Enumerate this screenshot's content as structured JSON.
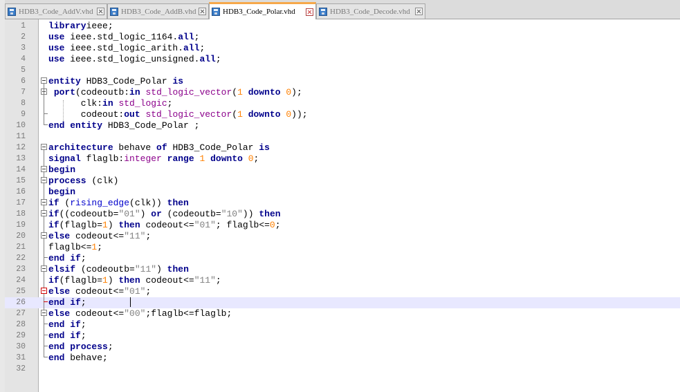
{
  "tabs": [
    {
      "label": "HDB3_Code_AddV.vhd",
      "active": false
    },
    {
      "label": "HDB3_Code_AddB.vhd",
      "active": false
    },
    {
      "label": "HDB3_Code_Polar.vhd",
      "active": true
    },
    {
      "label": "HDB3_Code_Decode.vhd",
      "active": false
    }
  ],
  "editor": {
    "current_line": 26,
    "line_numbers": [
      "1",
      "2",
      "3",
      "4",
      "5",
      "6",
      "7",
      "8",
      "9",
      "10",
      "11",
      "12",
      "13",
      "14",
      "15",
      "16",
      "17",
      "18",
      "19",
      "20",
      "21",
      "22",
      "23",
      "24",
      "25",
      "26",
      "27",
      "28",
      "29",
      "30",
      "31",
      "32"
    ],
    "lines": [
      [
        [
          "kw",
          "library"
        ],
        [
          "",
          "ieee;"
        ]
      ],
      [
        [
          "kw",
          "use"
        ],
        [
          "",
          " ieee.std_logic_1164."
        ],
        [
          "kw",
          "all"
        ],
        [
          "",
          ";"
        ]
      ],
      [
        [
          "kw",
          "use"
        ],
        [
          "",
          " ieee.std_logic_arith."
        ],
        [
          "kw",
          "all"
        ],
        [
          "",
          ";"
        ]
      ],
      [
        [
          "kw",
          "use"
        ],
        [
          "",
          " ieee.std_logic_unsigned."
        ],
        [
          "kw",
          "all"
        ],
        [
          "",
          ";"
        ]
      ],
      [],
      [
        [
          "kw",
          "entity"
        ],
        [
          "",
          " HDB3_Code_Polar "
        ],
        [
          "kw",
          "is"
        ]
      ],
      [
        [
          "",
          " "
        ],
        [
          "kw",
          "port"
        ],
        [
          "",
          "(codeoutb:"
        ],
        [
          "kw",
          "in"
        ],
        [
          "",
          " "
        ],
        [
          "ty",
          "std_logic_vector"
        ],
        [
          "",
          "("
        ],
        [
          "num",
          "1"
        ],
        [
          "",
          " "
        ],
        [
          "kw",
          "downto"
        ],
        [
          "",
          " "
        ],
        [
          "num",
          "0"
        ],
        [
          "",
          ");"
        ]
      ],
      [
        [
          "",
          "      clk:"
        ],
        [
          "kw",
          "in"
        ],
        [
          "",
          " "
        ],
        [
          "ty",
          "std_logic"
        ],
        [
          "",
          ";"
        ]
      ],
      [
        [
          "",
          "      codeout:"
        ],
        [
          "kw",
          "out"
        ],
        [
          "",
          " "
        ],
        [
          "ty",
          "std_logic_vector"
        ],
        [
          "",
          "("
        ],
        [
          "num",
          "1"
        ],
        [
          "",
          " "
        ],
        [
          "kw",
          "downto"
        ],
        [
          "",
          " "
        ],
        [
          "num",
          "0"
        ],
        [
          "",
          "));"
        ]
      ],
      [
        [
          "kw",
          "end"
        ],
        [
          "",
          " "
        ],
        [
          "kw",
          "entity"
        ],
        [
          "",
          " HDB3_Code_Polar ;"
        ]
      ],
      [],
      [
        [
          "kw",
          "architecture"
        ],
        [
          "",
          " behave "
        ],
        [
          "kw",
          "of"
        ],
        [
          "",
          " HDB3_Code_Polar "
        ],
        [
          "kw",
          "is"
        ]
      ],
      [
        [
          "kw",
          "signal"
        ],
        [
          "",
          " flaglb:"
        ],
        [
          "ty",
          "integer"
        ],
        [
          "",
          " "
        ],
        [
          "kw",
          "range"
        ],
        [
          "",
          " "
        ],
        [
          "num",
          "1"
        ],
        [
          "",
          " "
        ],
        [
          "kw",
          "downto"
        ],
        [
          "",
          " "
        ],
        [
          "num",
          "0"
        ],
        [
          "",
          ";"
        ]
      ],
      [
        [
          "kw",
          "begin"
        ]
      ],
      [
        [
          "kw",
          "process"
        ],
        [
          "",
          " (clk)"
        ]
      ],
      [
        [
          "kw",
          "begin"
        ]
      ],
      [
        [
          "kw",
          "if"
        ],
        [
          "",
          " ("
        ],
        [
          "fn",
          "rising_edge"
        ],
        [
          "",
          "(clk)) "
        ],
        [
          "kw",
          "then"
        ]
      ],
      [
        [
          "kw",
          "if"
        ],
        [
          "",
          "((codeoutb="
        ],
        [
          "str",
          "\"01\""
        ],
        [
          "",
          ") "
        ],
        [
          "kw",
          "or"
        ],
        [
          "",
          " (codeoutb="
        ],
        [
          "str",
          "\"10\""
        ],
        [
          "",
          "))"
        ],
        [
          "",
          " "
        ],
        [
          "kw",
          "then"
        ]
      ],
      [
        [
          "kw",
          "if"
        ],
        [
          "",
          "(flaglb="
        ],
        [
          "num",
          "1"
        ],
        [
          "",
          ") "
        ],
        [
          "kw",
          "then"
        ],
        [
          "",
          " codeout<="
        ],
        [
          "str",
          "\"01\""
        ],
        [
          "",
          "; flaglb<="
        ],
        [
          "num",
          "0"
        ],
        [
          "",
          ";"
        ]
      ],
      [
        [
          "kw",
          "else"
        ],
        [
          "",
          " codeout<="
        ],
        [
          "str",
          "\"11\""
        ],
        [
          "",
          ";"
        ]
      ],
      [
        [
          "",
          "flaglb<="
        ],
        [
          "num",
          "1"
        ],
        [
          "",
          ";"
        ]
      ],
      [
        [
          "kw",
          "end"
        ],
        [
          "",
          " "
        ],
        [
          "kw",
          "if"
        ],
        [
          "",
          ";"
        ]
      ],
      [
        [
          "kw",
          "elsif"
        ],
        [
          "",
          " (codeoutb="
        ],
        [
          "str",
          "\"11\""
        ],
        [
          "",
          ") "
        ],
        [
          "kw",
          "then"
        ]
      ],
      [
        [
          "kw",
          "if"
        ],
        [
          "",
          "(flaglb="
        ],
        [
          "num",
          "1"
        ],
        [
          "",
          ") "
        ],
        [
          "kw",
          "then"
        ],
        [
          "",
          " codeout<="
        ],
        [
          "str",
          "\"11\""
        ],
        [
          "",
          ";"
        ]
      ],
      [
        [
          "kw",
          "else"
        ],
        [
          "",
          " codeout<="
        ],
        [
          "str",
          "\"01\""
        ],
        [
          "",
          ";"
        ]
      ],
      [
        [
          "kw",
          "end"
        ],
        [
          "",
          " "
        ],
        [
          "kw",
          "if"
        ],
        [
          "",
          ";"
        ]
      ],
      [
        [
          "kw",
          "else"
        ],
        [
          "",
          " codeout<="
        ],
        [
          "str",
          "\"00\""
        ],
        [
          "",
          ";flaglb<=flaglb;"
        ]
      ],
      [
        [
          "kw",
          "end"
        ],
        [
          "",
          " "
        ],
        [
          "kw",
          "if"
        ],
        [
          "",
          ";"
        ]
      ],
      [
        [
          "kw",
          "end"
        ],
        [
          "",
          " "
        ],
        [
          "kw",
          "if"
        ],
        [
          "",
          ";"
        ]
      ],
      [
        [
          "kw",
          "end"
        ],
        [
          "",
          " "
        ],
        [
          "kw",
          "process"
        ],
        [
          "",
          ";"
        ]
      ],
      [
        [
          "kw",
          "end"
        ],
        [
          "",
          " behave;"
        ]
      ],
      []
    ]
  }
}
